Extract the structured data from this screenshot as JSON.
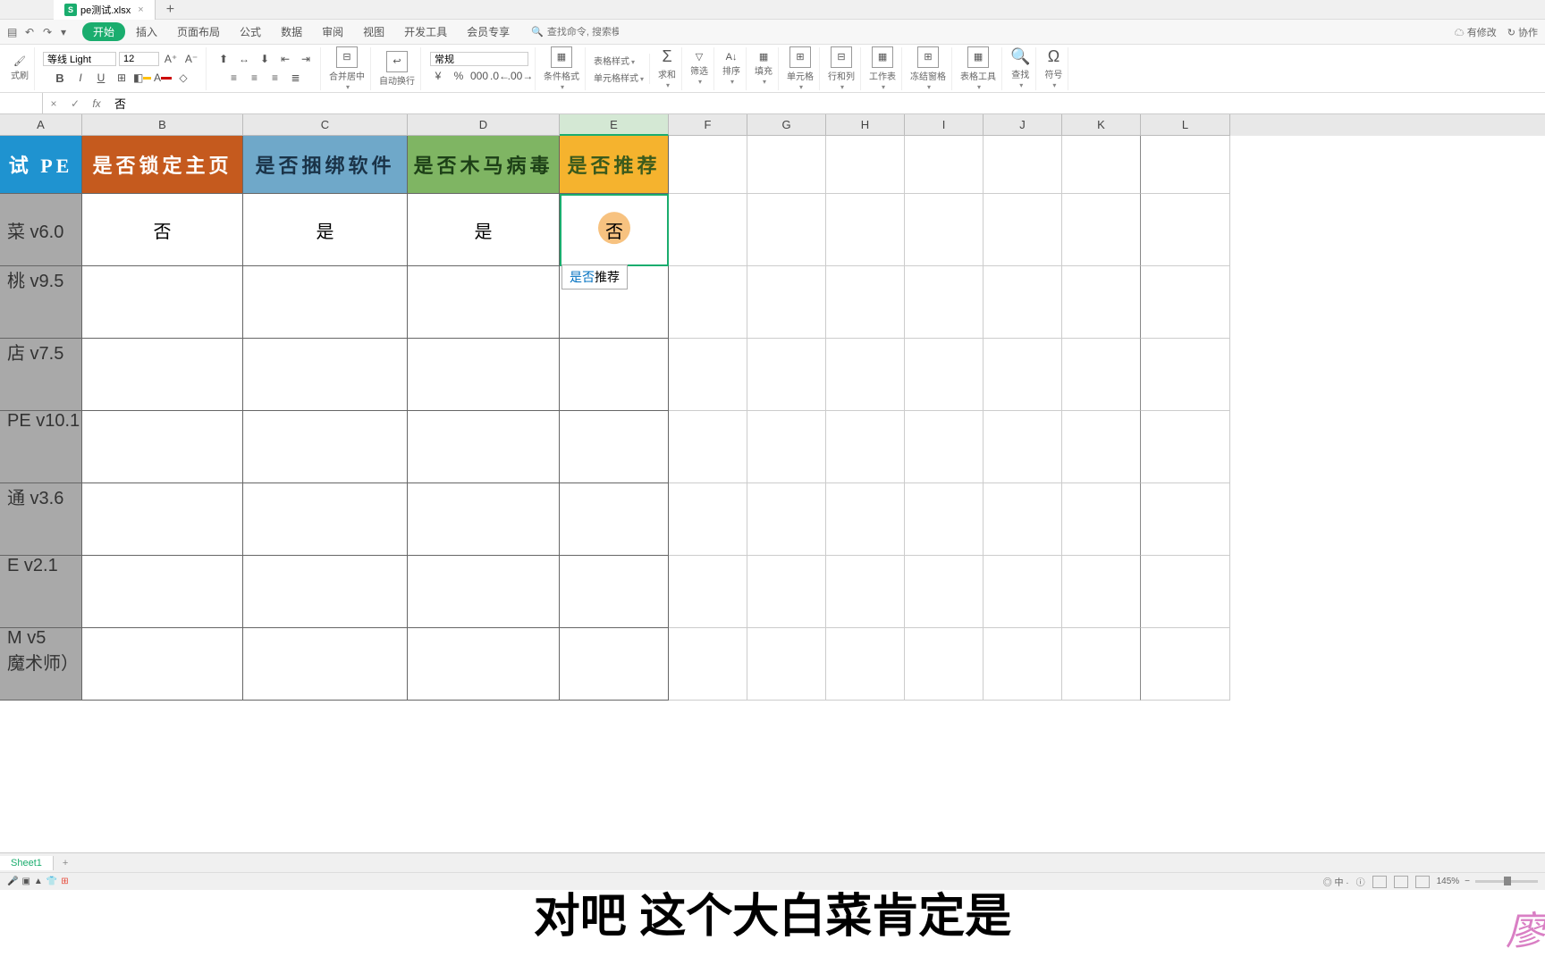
{
  "tab": {
    "filename": "pe测试.xlsx"
  },
  "menu": {
    "tabs": [
      "开始",
      "插入",
      "页面布局",
      "公式",
      "数据",
      "审阅",
      "视图",
      "开发工具",
      "会员专享"
    ],
    "search_placeholder": "查找命令, 搜索模板",
    "right_changes": "有修改",
    "right_sync": "协作"
  },
  "ribbon": {
    "brush": "式刷",
    "font_name": "等线 Light",
    "font_size": "12",
    "merge": "合并居中",
    "wrap": "自动换行",
    "number_format": "常规",
    "cond_format": "条件格式",
    "table_style": "表格样式",
    "cell_style": "单元格样式",
    "sum": "求和",
    "filter": "筛选",
    "sort": "排序",
    "fill": "填充",
    "cell": "单元格",
    "rowcol": "行和列",
    "worksheet": "工作表",
    "freeze": "冻结窗格",
    "table_tools": "表格工具",
    "find": "查找",
    "symbol": "符号"
  },
  "formula_bar": {
    "name_box": "",
    "value": "否"
  },
  "columns": [
    "A",
    "B",
    "C",
    "D",
    "E",
    "F",
    "G",
    "H",
    "I",
    "J",
    "K",
    "L"
  ],
  "headers": [
    "试 PE",
    "是否锁定主页",
    "是否捆绑软件",
    "是否木马病毒",
    "是否推荐"
  ],
  "rows": [
    {
      "a": "菜 v6.0",
      "b": "否",
      "c": "是",
      "d": "是",
      "e": "否"
    },
    {
      "a": "桃 v9.5",
      "b": "",
      "c": "",
      "d": "",
      "e": ""
    },
    {
      "a": "店 v7.5",
      "b": "",
      "c": "",
      "d": "",
      "e": ""
    },
    {
      "a": "PE v10.1",
      "b": "",
      "c": "",
      "d": "",
      "e": ""
    },
    {
      "a": "通 v3.6",
      "b": "",
      "c": "",
      "d": "",
      "e": ""
    },
    {
      "a": "E v2.1",
      "b": "",
      "c": "",
      "d": "",
      "e": ""
    },
    {
      "a": "M v5\n魔术师）",
      "b": "",
      "c": "",
      "d": "",
      "e": ""
    }
  ],
  "autocomplete": {
    "match": "是否",
    "rest": "推荐"
  },
  "sheet_tab": "Sheet1",
  "status": {
    "zoom": "145%"
  },
  "subtitle": "对吧 这个大白菜肯定是",
  "watermark": "廖"
}
